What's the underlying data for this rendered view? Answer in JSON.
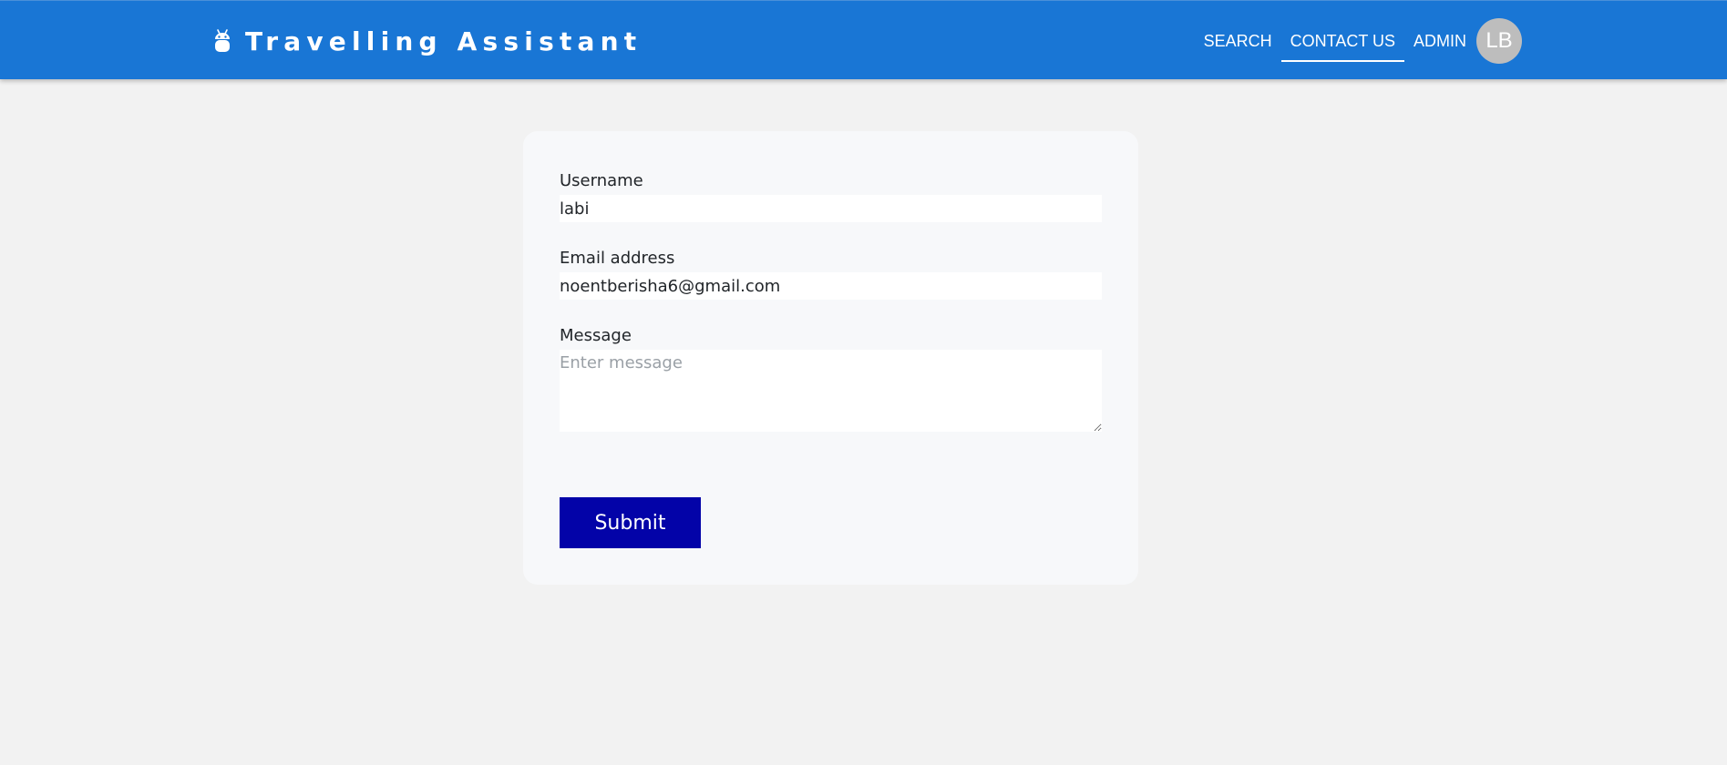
{
  "navbar": {
    "brand_icon": "android-icon",
    "brand_title": "Travelling Assistant",
    "links": {
      "search": "SEARCH",
      "contact": "CONTACT US",
      "admin": "ADMIN"
    },
    "avatar_initials": "LB",
    "colors": {
      "background": "#1976d5",
      "avatar": "#bdbdbd"
    }
  },
  "form": {
    "username": {
      "label": "Username",
      "value": "labi"
    },
    "email": {
      "label": "Email address",
      "value": "noentberisha6@gmail.com"
    },
    "message": {
      "label": "Message",
      "value": "",
      "placeholder": "Enter message"
    },
    "submit_label": "Submit",
    "colors": {
      "submit": "#0303a8"
    }
  }
}
